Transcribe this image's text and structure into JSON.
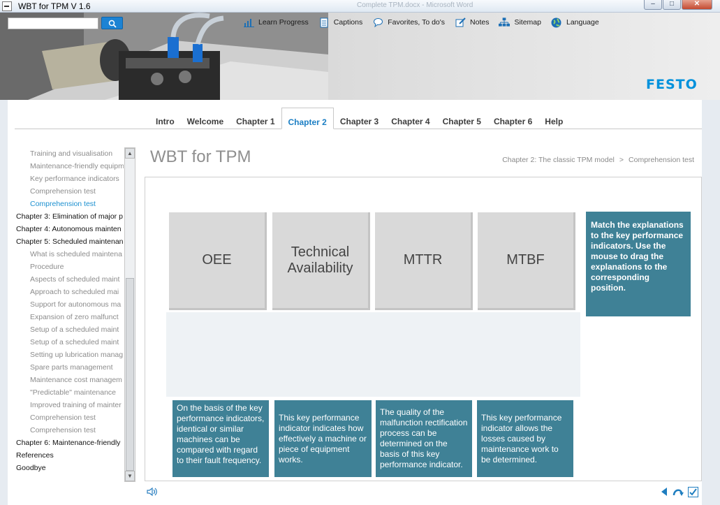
{
  "window": {
    "title": "WBT for TPM  V 1.6",
    "ghost_title": "Complete TPM.docx - Microsoft Word",
    "min": "–",
    "max": "□",
    "close": "✕"
  },
  "search": {
    "value": "",
    "button": "🔍"
  },
  "toolbar": {
    "items": [
      {
        "label": "Learn Progress",
        "icon": "bar-chart-icon"
      },
      {
        "label": "Captions",
        "icon": "document-icon"
      },
      {
        "label": "Favorites, To do's",
        "icon": "speech-bubble-icon"
      },
      {
        "label": "Notes",
        "icon": "pencil-icon"
      },
      {
        "label": "Sitemap",
        "icon": "sitemap-icon"
      },
      {
        "label": "Language",
        "icon": "globe-icon"
      }
    ]
  },
  "brand": {
    "logo": "FESTO",
    "color": "#0091dc"
  },
  "nav": {
    "tabs": [
      "Intro",
      "Welcome",
      "Chapter 1",
      "Chapter 2",
      "Chapter 3",
      "Chapter 4",
      "Chapter 5",
      "Chapter 6",
      "Help"
    ],
    "active": "Chapter 2"
  },
  "sidebar": {
    "items": [
      {
        "label": "Training and visualisation",
        "level": 1
      },
      {
        "label": "Maintenance-friendly equipment",
        "level": 1
      },
      {
        "label": "Key performance indicators",
        "level": 1
      },
      {
        "label": "Comprehension test",
        "level": 1
      },
      {
        "label": "Comprehension test",
        "level": 1,
        "current": true
      },
      {
        "label": "Chapter 3: Elimination of major p",
        "level": 0
      },
      {
        "label": "Chapter 4: Autonomous mainten",
        "level": 0
      },
      {
        "label": "Chapter 5: Scheduled maintenan",
        "level": 0
      },
      {
        "label": "What is scheduled maintena",
        "level": 1
      },
      {
        "label": "Procedure",
        "level": 1
      },
      {
        "label": "Aspects of scheduled maint",
        "level": 1
      },
      {
        "label": "Approach to scheduled mai",
        "level": 1
      },
      {
        "label": "Support for autonomous ma",
        "level": 1
      },
      {
        "label": "Expansion of zero malfunct",
        "level": 1
      },
      {
        "label": "Setup of a scheduled maint",
        "level": 1
      },
      {
        "label": "Setup of a scheduled maint",
        "level": 1
      },
      {
        "label": "Setting up lubrication manag",
        "level": 1
      },
      {
        "label": "Spare parts management",
        "level": 1
      },
      {
        "label": "Maintenance cost managem",
        "level": 1
      },
      {
        "label": "\"Predictable\" maintenance",
        "level": 1
      },
      {
        "label": "Improved training of mainter",
        "level": 1
      },
      {
        "label": "Comprehension test",
        "level": 1
      },
      {
        "label": "Comprehension test",
        "level": 1
      },
      {
        "label": "Chapter 6: Maintenance-friendly",
        "level": 0
      },
      {
        "label": "References",
        "level": 0
      },
      {
        "label": "Goodbye",
        "level": 0
      }
    ]
  },
  "page": {
    "title": "WBT for TPM",
    "breadcrumb": [
      "Chapter 2: The classic TPM model",
      ">",
      "Comprehension test"
    ]
  },
  "exercise": {
    "kpis": [
      {
        "label_lines": [
          "OEE"
        ]
      },
      {
        "label_lines": [
          "Technical",
          "Availability"
        ]
      },
      {
        "label_lines": [
          "MTTR"
        ]
      },
      {
        "label_lines": [
          "MTBF"
        ]
      }
    ],
    "instruction": "Match the explanations to the key performance indicators. Use the mouse to drag the explanations to the corresponding position.",
    "cards": [
      "On the basis of the key performance indicators, identical or similar machines can be compared with regard to their fault frequency.",
      "This key performance indicator indicates how effectively a machine or piece of equipment works.",
      "The quality of the malfunction rectification process can be determined on the basis of this key performance indicator.",
      "This key performance indicator allows the losses caused by maintenance work to be determined."
    ]
  },
  "colors": {
    "accent": "#1c7fc4",
    "card": "#3f8196",
    "active_item": "#1c90d0"
  }
}
